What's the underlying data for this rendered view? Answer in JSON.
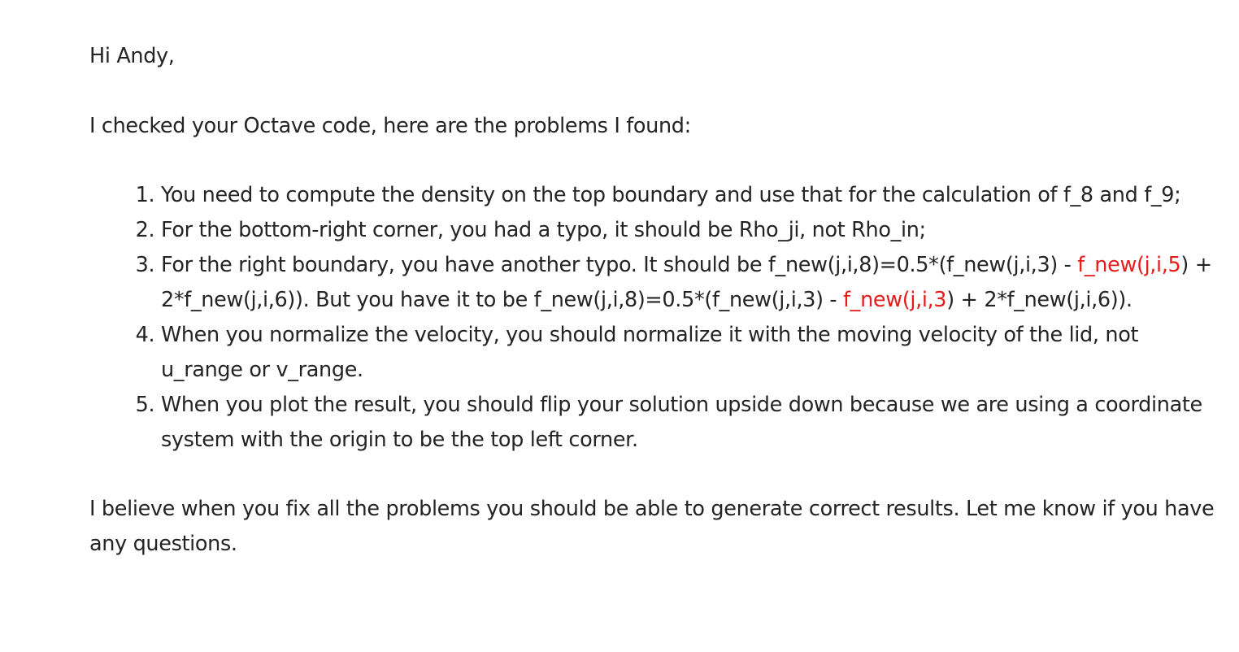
{
  "email": {
    "greeting": "Hi Andy,",
    "intro": "I checked your Octave code, here are the problems I found:",
    "items": [
      {
        "text": "You need to compute the density on the top boundary and use that for the calculation of f_8 and f_9;"
      },
      {
        "text": "For the bottom-right corner, you had a typo, it should be Rho_ji, not Rho_in;"
      },
      {
        "part1": "For the right boundary, you have another typo. It should be f_new(j,i,8)=0.5*(f_new(j,i,3) - ",
        "red1": "f_new(j,i,5",
        "part2": ") + 2*f_new(j,i,6)). But you have it to be f_new(j,i,8)=0.5*(f_new(j,i,3) - ",
        "red2": "f_new(j,i,3",
        "part3": ") + 2*f_new(j,i,6))."
      },
      {
        "text": "When you normalize the velocity, you should normalize it with the moving velocity of the lid, not u_range or v_range."
      },
      {
        "text": "When you plot the result, you should flip your solution upside down because we are using a coordinate system with the origin to be the top left corner."
      }
    ],
    "closing": "I believe when you fix all the problems you should be able to generate correct results. Let me know if you have any questions.",
    "highlight_color": "#e81b1b",
    "text_color": "#242424"
  }
}
